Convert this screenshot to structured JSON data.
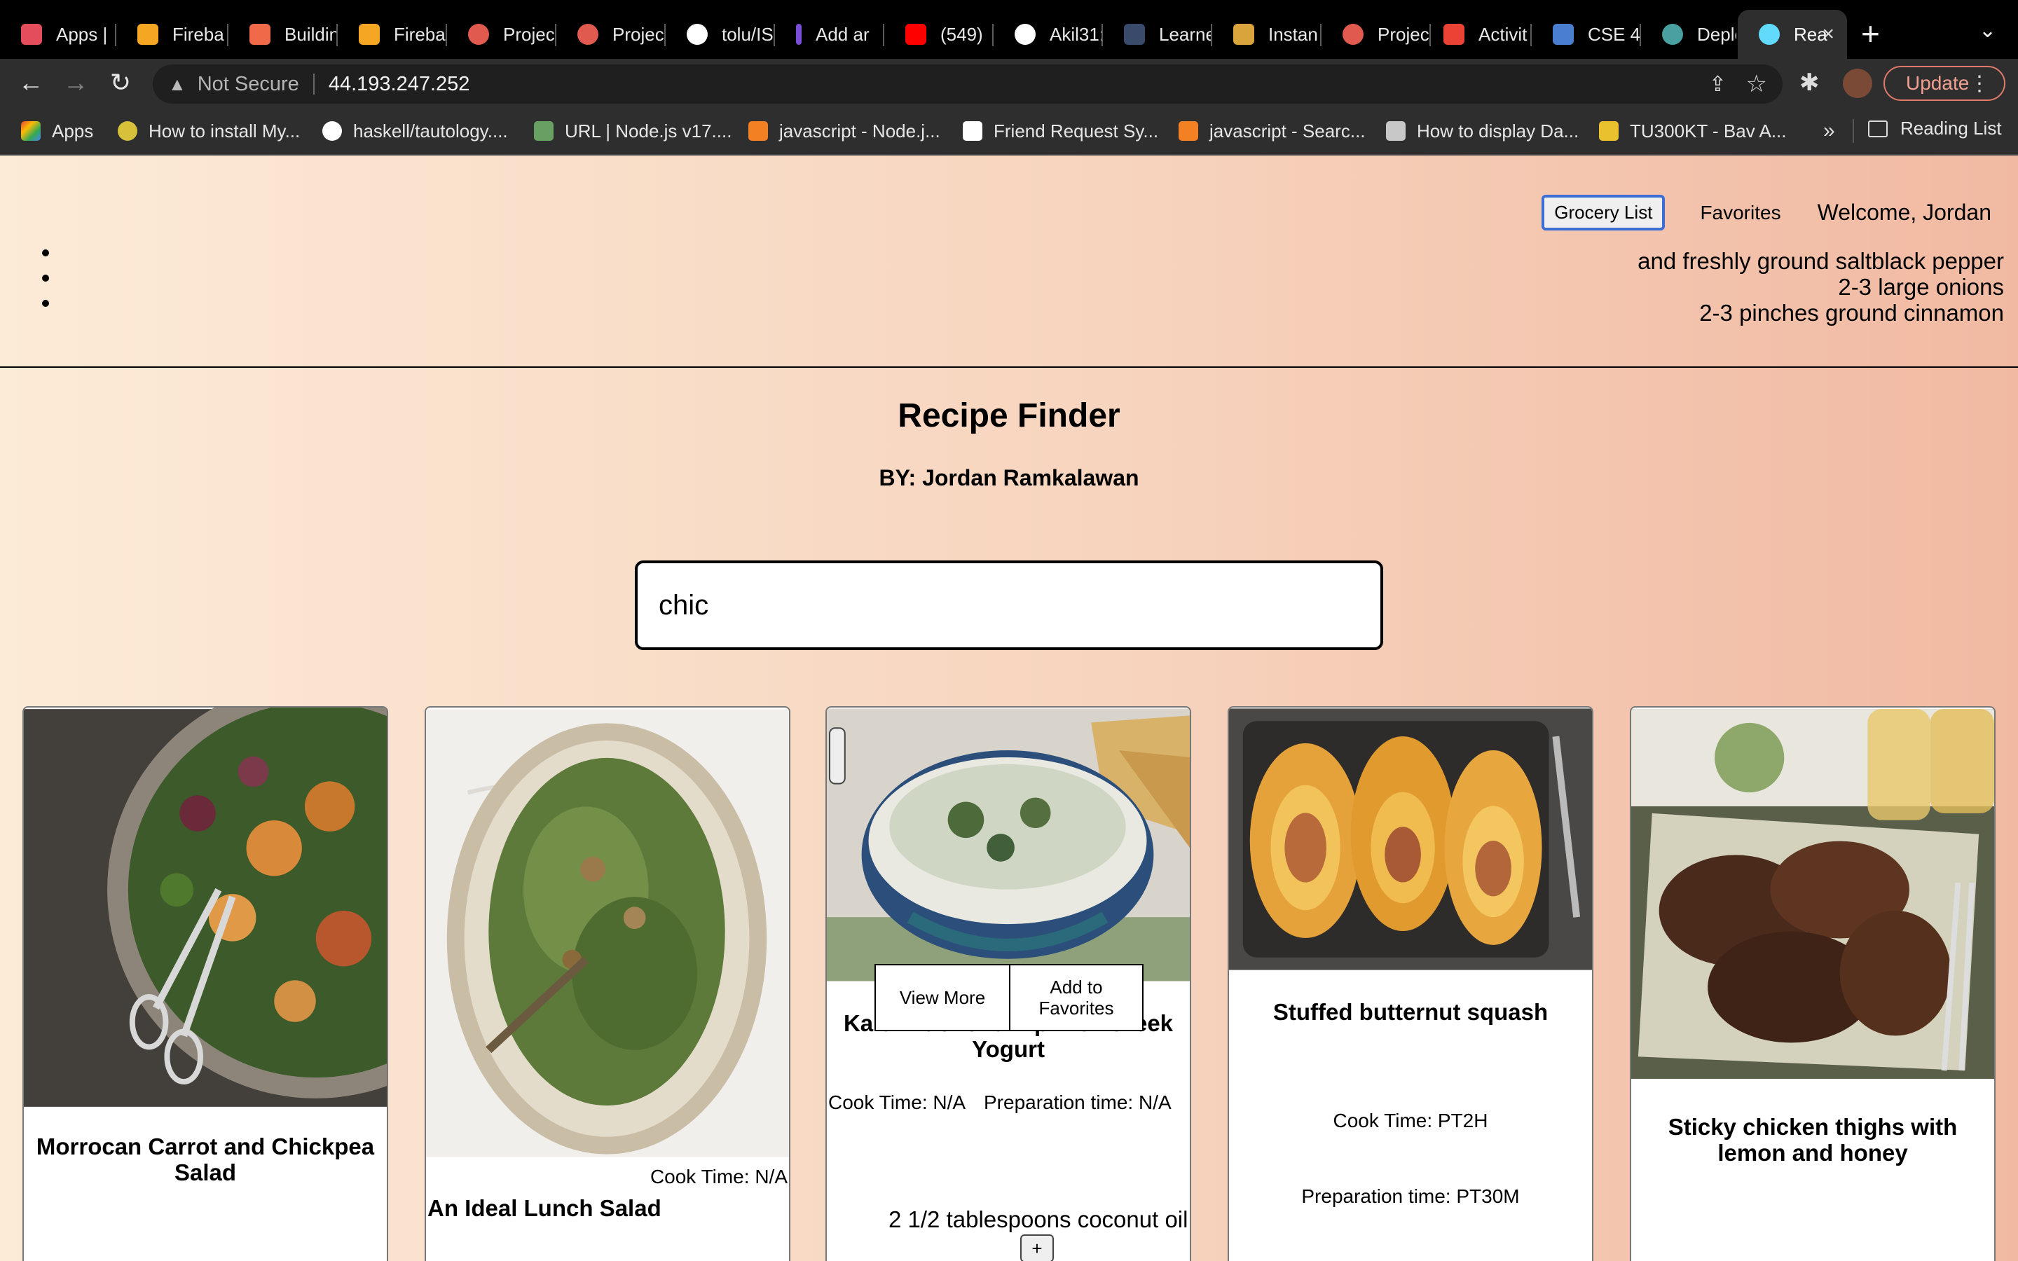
{
  "browser": {
    "tabs": [
      {
        "label": "Apps |",
        "color": "#e44d5b"
      },
      {
        "label": "Fireba",
        "color": "#f5a623"
      },
      {
        "label": "Buildin",
        "color": "#f06a4a"
      },
      {
        "label": "Fireba",
        "color": "#f5a623"
      },
      {
        "label": "Projec",
        "color": "#e05a4f"
      },
      {
        "label": "Projec",
        "color": "#e05a4f"
      },
      {
        "label": "tolu/IS",
        "color": "#ffffff"
      },
      {
        "label": "Add ar",
        "color": "#7a4dd8"
      },
      {
        "label": "(549)",
        "color": "#ff0000"
      },
      {
        "label": "Akil31:",
        "color": "#ffffff"
      },
      {
        "label": "Learne",
        "color": "#3a4a6a"
      },
      {
        "label": "Instan",
        "color": "#d9a43b"
      },
      {
        "label": "Projec",
        "color": "#e05a4f"
      },
      {
        "label": "Activit",
        "color": "#ea4335"
      },
      {
        "label": "CSE 4:",
        "color": "#4a7fd0"
      },
      {
        "label": "Deploy",
        "color": "#4aa0a0"
      },
      {
        "label": "Rea",
        "color": "#61dafb",
        "active": true
      }
    ],
    "close_icon": "×",
    "new_tab_icon": "+",
    "tab_menu_icon": "⌄",
    "nav": {
      "back_icon": "←",
      "forward_icon": "→",
      "reload_icon": "↻"
    },
    "omnibox": {
      "security_icon": "▲",
      "security_label": "Not Secure",
      "url": "44.193.247.252",
      "share_icon": "⇪",
      "star_icon": "☆"
    },
    "extensions_icon": "✱",
    "update_label": "Update",
    "menu_icon": "⋮",
    "bookmarks": [
      {
        "label": "Apps",
        "color": "#e44d5b"
      },
      {
        "label": "How to install My...",
        "color": "#d7c13a"
      },
      {
        "label": "haskell/tautology....",
        "color": "#ffffff"
      },
      {
        "label": "URL | Node.js v17....",
        "color": "#68a063"
      },
      {
        "label": "javascript - Node.j...",
        "color": "#f48024"
      },
      {
        "label": "Friend Request Sy...",
        "color": "#ffffff"
      },
      {
        "label": "javascript - Searc...",
        "color": "#f48024"
      },
      {
        "label": "How to display Da...",
        "color": "#c8c8c8"
      },
      {
        "label": "TU300KT - Bav A...",
        "color": "#e9c02e"
      }
    ],
    "bookmarks_more": "»",
    "reading_list": "Reading List"
  },
  "header": {
    "grocery_button": "Grocery List",
    "favorites_link": "Favorites",
    "welcome": "Welcome, Jordan"
  },
  "grocery_items": [
    "and freshly ground saltblack pepper",
    "2-3 large onions",
    "2-3 pinches ground cinnamon"
  ],
  "title": "Recipe Finder",
  "byline": "BY: Jordan Ramkalawan",
  "search": {
    "value": "chic"
  },
  "recipes": [
    {
      "name": "Morrocan Carrot and Chickpea Salad",
      "image": "bowl of carrot and chickpea salad with serving tongs"
    },
    {
      "name": "An Ideal Lunch Salad",
      "cook_time": "Cook Time: N/A",
      "image": "bowl of leafy green salad"
    },
    {
      "name": "Kale Artichoke Dip with Greek Yogurt",
      "cook_time": "Cook Time: N/A",
      "prep_time": "Preparation time: N/A",
      "view_more": "View More",
      "add_favorites": "Add to Favorites",
      "ingredient": "2 1/2 tablespoons coconut oil",
      "add_icon": "+",
      "image": "bowl of kale artichoke dip with chips"
    },
    {
      "name": "Stuffed butternut squash",
      "cook_time": "Cook Time: PT2H",
      "prep_time": "Preparation time: PT30M",
      "image": "roasted stuffed butternut squash halves in a tray"
    },
    {
      "name": "Sticky chicken thighs with lemon and honey",
      "image": "plate of glazed chicken thighs"
    }
  ]
}
